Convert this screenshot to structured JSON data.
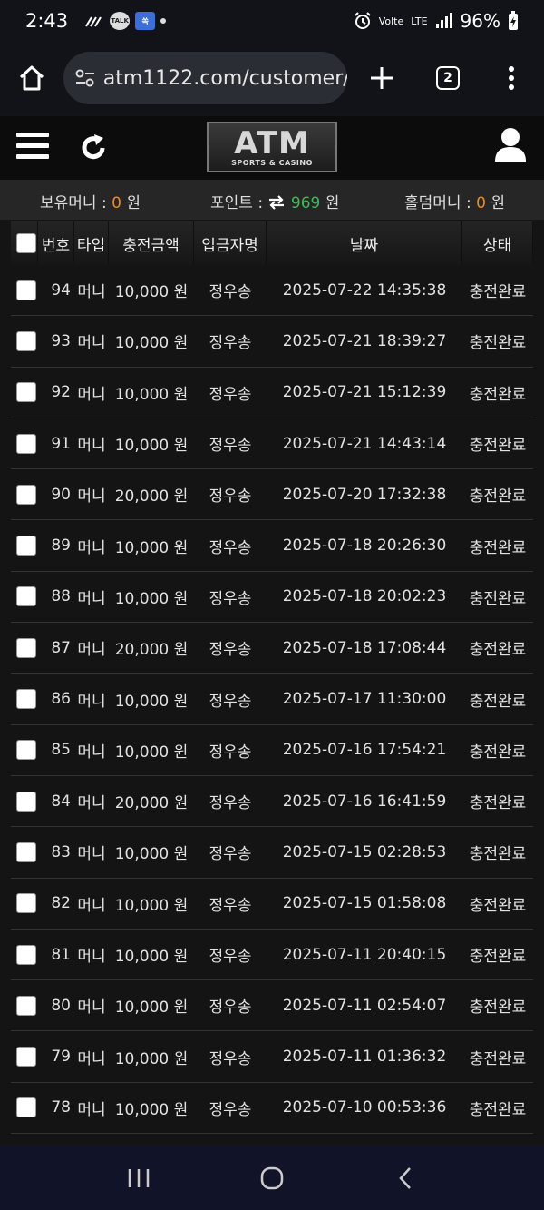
{
  "status_bar": {
    "time": "2:43",
    "talk_badge": "TALK",
    "blue_app_badge": "쏙",
    "volte": "Volte",
    "network": "LTE",
    "battery": "96%"
  },
  "browser": {
    "url": "atm1122.com/customer/",
    "tab_count": "2"
  },
  "site": {
    "logo_main": "ATM",
    "logo_sub": "SPORTS & CASINO"
  },
  "balance": {
    "money_label": "보유머니 :",
    "money_value": "0",
    "money_unit": "원",
    "point_label": "포인트 :",
    "point_value": "969",
    "point_unit": "원",
    "holdem_label": "홀덤머니 :",
    "holdem_value": "0",
    "holdem_unit": "원"
  },
  "table": {
    "headers": {
      "no": "번호",
      "type": "타입",
      "amount": "충전금액",
      "depositor": "입금자명",
      "date": "날짜",
      "status": "상태"
    },
    "rows": [
      {
        "no": "94",
        "type": "머니",
        "amount": "10,000 원",
        "name": "정우송",
        "date": "2025-07-22 14:35:38",
        "status": "충전완료"
      },
      {
        "no": "93",
        "type": "머니",
        "amount": "10,000 원",
        "name": "정우송",
        "date": "2025-07-21 18:39:27",
        "status": "충전완료"
      },
      {
        "no": "92",
        "type": "머니",
        "amount": "10,000 원",
        "name": "정우송",
        "date": "2025-07-21 15:12:39",
        "status": "충전완료"
      },
      {
        "no": "91",
        "type": "머니",
        "amount": "10,000 원",
        "name": "정우송",
        "date": "2025-07-21 14:43:14",
        "status": "충전완료"
      },
      {
        "no": "90",
        "type": "머니",
        "amount": "20,000 원",
        "name": "정우송",
        "date": "2025-07-20 17:32:38",
        "status": "충전완료"
      },
      {
        "no": "89",
        "type": "머니",
        "amount": "10,000 원",
        "name": "정우송",
        "date": "2025-07-18 20:26:30",
        "status": "충전완료"
      },
      {
        "no": "88",
        "type": "머니",
        "amount": "10,000 원",
        "name": "정우송",
        "date": "2025-07-18 20:02:23",
        "status": "충전완료"
      },
      {
        "no": "87",
        "type": "머니",
        "amount": "20,000 원",
        "name": "정우송",
        "date": "2025-07-18 17:08:44",
        "status": "충전완료"
      },
      {
        "no": "86",
        "type": "머니",
        "amount": "10,000 원",
        "name": "정우송",
        "date": "2025-07-17 11:30:00",
        "status": "충전완료"
      },
      {
        "no": "85",
        "type": "머니",
        "amount": "10,000 원",
        "name": "정우송",
        "date": "2025-07-16 17:54:21",
        "status": "충전완료"
      },
      {
        "no": "84",
        "type": "머니",
        "amount": "20,000 원",
        "name": "정우송",
        "date": "2025-07-16 16:41:59",
        "status": "충전완료"
      },
      {
        "no": "83",
        "type": "머니",
        "amount": "10,000 원",
        "name": "정우송",
        "date": "2025-07-15 02:28:53",
        "status": "충전완료"
      },
      {
        "no": "82",
        "type": "머니",
        "amount": "10,000 원",
        "name": "정우송",
        "date": "2025-07-15 01:58:08",
        "status": "충전완료"
      },
      {
        "no": "81",
        "type": "머니",
        "amount": "10,000 원",
        "name": "정우송",
        "date": "2025-07-11 20:40:15",
        "status": "충전완료"
      },
      {
        "no": "80",
        "type": "머니",
        "amount": "10,000 원",
        "name": "정우송",
        "date": "2025-07-11 02:54:07",
        "status": "충전완료"
      },
      {
        "no": "79",
        "type": "머니",
        "amount": "10,000 원",
        "name": "정우송",
        "date": "2025-07-11 01:36:32",
        "status": "충전완료"
      },
      {
        "no": "78",
        "type": "머니",
        "amount": "10,000 원",
        "name": "정우송",
        "date": "2025-07-10 00:53:36",
        "status": "충전완료"
      }
    ]
  },
  "colors": {
    "accent_orange": "#f08a24",
    "accent_green": "#3dbb5a"
  }
}
